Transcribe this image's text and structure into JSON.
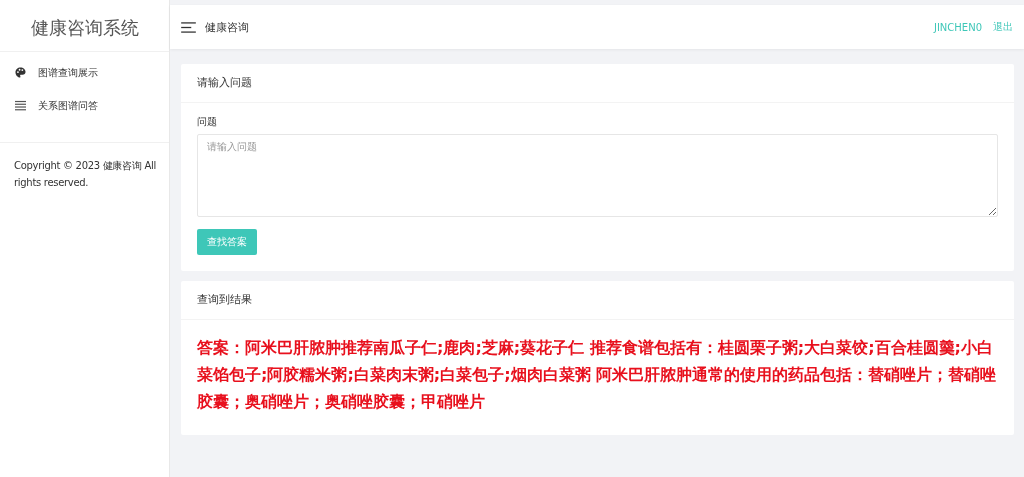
{
  "sidebar": {
    "title": "健康咨询系统",
    "items": [
      {
        "label": "图谱查询展示"
      },
      {
        "label": "关系图谱问答"
      }
    ],
    "copyright": "Copyright © 2023 健康咨询 All rights reserved."
  },
  "header": {
    "title": "健康咨询",
    "user": "JINCHEN0",
    "logout": "退出"
  },
  "question_card": {
    "title": "请输入问题",
    "field_label": "问题",
    "placeholder": "请输入问题",
    "button": "查找答案"
  },
  "result_card": {
    "title": "查询到结果",
    "answer": "答案：阿米巴肝脓肿推荐南瓜子仁;鹿肉;芝麻;葵花子仁 推荐食谱包括有：桂圆栗子粥;大白菜饺;百合桂圆羹;小白菜馅包子;阿胶糯米粥;白菜肉末粥;白菜包子;烟肉白菜粥 阿米巴肝脓肿通常的使用的药品包括：替硝唑片；替硝唑胶囊；奥硝唑片；奥硝唑胶囊；甲硝唑片"
  }
}
